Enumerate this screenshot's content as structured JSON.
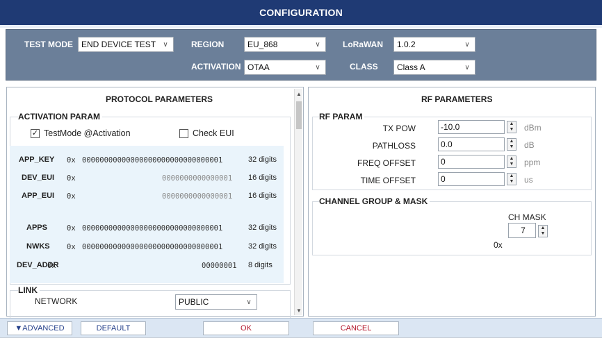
{
  "window": {
    "title": "CONFIGURATION"
  },
  "topbar": {
    "test_mode_label": "TEST MODE",
    "test_mode_value": "END DEVICE TEST",
    "region_label": "REGION",
    "region_value": "EU_868",
    "activation_label": "ACTIVATION",
    "activation_value": "OTAA",
    "lorawan_label": "LoRaWAN",
    "lorawan_value": "1.0.2",
    "class_label": "CLASS",
    "class_value": "Class A",
    "chevron_icon": "chevron-down-icon"
  },
  "protocol": {
    "title": "PROTOCOL PARAMETERS",
    "activation_group": "ACTIVATION PARAM",
    "testmode_label": "TestMode @Activation",
    "testmode_checked": "✓",
    "check_eui_label": "Check EUI",
    "keys": [
      {
        "label": "APP_KEY",
        "prefix": "0x",
        "value": "00000000000000000000000000000001",
        "digits": "32 digits"
      },
      {
        "label": "DEV_EUI",
        "prefix": "0x",
        "value": "0000000000000001",
        "digits": "16 digits"
      },
      {
        "label": "APP_EUI",
        "prefix": "0x",
        "value": "0000000000000001",
        "digits": "16 digits"
      },
      {
        "label": "APPS",
        "prefix": "0x",
        "value": "00000000000000000000000000000001",
        "digits": "32 digits"
      },
      {
        "label": "NWKS",
        "prefix": "0x",
        "value": "00000000000000000000000000000001",
        "digits": "32 digits"
      },
      {
        "label": "DEV_ADDR",
        "prefix": "0x",
        "value": "00000001",
        "digits": "8 digits"
      }
    ],
    "link_group": "LINK",
    "network_label": "NETWORK",
    "network_value": "PUBLIC"
  },
  "rf": {
    "title": "RF PARAMETERS",
    "group": "RF PARAM",
    "rows": [
      {
        "label": "TX POW",
        "value": "-10.0",
        "unit": "dBm"
      },
      {
        "label": "PATHLOSS",
        "value": "0.0",
        "unit": "dB"
      },
      {
        "label": "FREQ OFFSET",
        "value": "0",
        "unit": "ppm"
      },
      {
        "label": "TIME OFFSET",
        "value": "0",
        "unit": "us"
      }
    ],
    "channel_group": "CHANNEL GROUP & MASK",
    "ch_mask_label": "CH MASK",
    "ch_mask_prefix": "0x",
    "ch_mask_value": "7"
  },
  "buttons": {
    "advanced": "▼ADVANCED",
    "default": "DEFAULT",
    "ok": "OK",
    "cancel": "CANCEL"
  },
  "colors": {
    "title_bg": "#1f3a74",
    "topbar_bg": "#6b7f99",
    "key_area_bg": "#eaf4fb",
    "cancel_color": "#b3152a",
    "button_text": "#233f8a"
  }
}
